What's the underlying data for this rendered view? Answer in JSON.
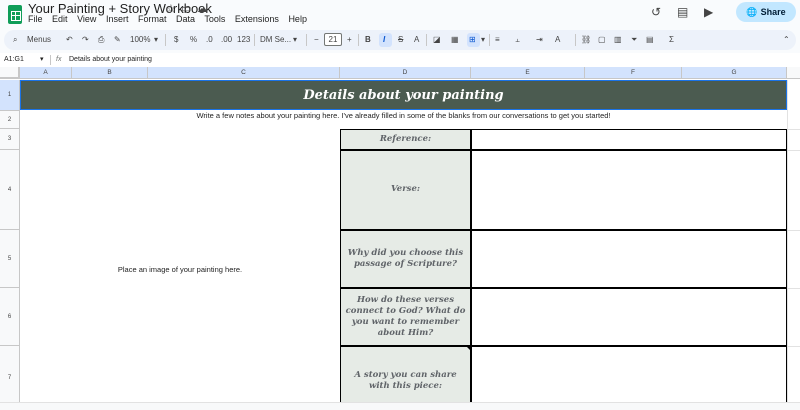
{
  "window": {
    "title": "Your Painting + Story Workbook"
  },
  "menu": [
    "File",
    "Edit",
    "View",
    "Insert",
    "Format",
    "Data",
    "Tools",
    "Extensions",
    "Help"
  ],
  "share": {
    "label": "Share"
  },
  "toolbar": {
    "search_label": "Menus",
    "zoom": "100%",
    "currency": "$",
    "percent": "%",
    "dec_decrease": ".0",
    "dec_increase": ".00",
    "number_format": "123",
    "font_name": "DM Se...",
    "font_size": "21",
    "minus": "−",
    "plus": "+",
    "bold": "B",
    "italic": "I",
    "strike": "S",
    "sigma": "Σ"
  },
  "formula_bar": {
    "cell_ref": "A1:G1",
    "fx": "fx",
    "content": "Details about your painting"
  },
  "columns": [
    "A",
    "B",
    "C",
    "D",
    "E",
    "F",
    "G"
  ],
  "rows": [
    "1",
    "2",
    "3",
    "4",
    "5",
    "6",
    "7"
  ],
  "sheet": {
    "banner": "Details about your painting",
    "intro": "Write a few notes about your painting here. I've already filled in some of the blanks from our conversations to get you started!",
    "image_placeholder": "Place an image of your painting here.",
    "questions": [
      "Reference:",
      "Verse:",
      "Why did you choose this passage of Scripture?",
      "How do these verses connect to God? What do you want to remember about Him?",
      "A story you can share with this piece:"
    ]
  },
  "colors": {
    "banner_bg": "#4b5b50",
    "label_bg": "#e6ebe6",
    "share_bg": "#c2e7ff",
    "accent": "#1a73e8"
  }
}
